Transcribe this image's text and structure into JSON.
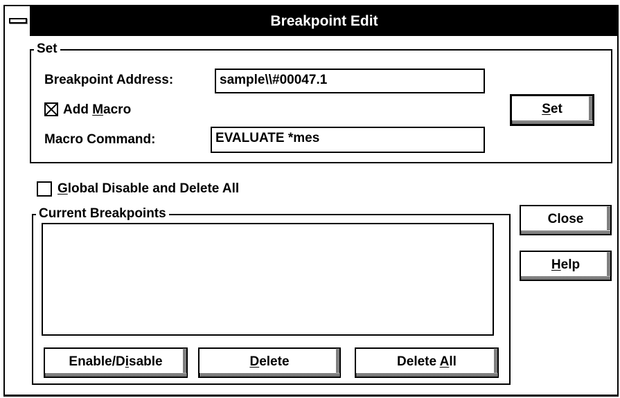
{
  "window": {
    "title": "Breakpoint Edit"
  },
  "set_group": {
    "label": "Set",
    "breakpoint_address_label": "Breakpoint Address:",
    "breakpoint_address_value": "sample\\\\#00047.1",
    "add_macro_label_pre": "Add ",
    "add_macro_label_key": "M",
    "add_macro_label_post": "acro",
    "add_macro_checked": true,
    "macro_command_label": "Macro Command:",
    "macro_command_value": "EVALUATE *mes",
    "set_button_key": "S",
    "set_button_rest": "et"
  },
  "global_disable": {
    "label_key": "G",
    "label_rest": "lobal Disable and Delete All",
    "checked": false
  },
  "current_breakpoints": {
    "label": "Current Breakpoints",
    "items": [],
    "enable_disable_pre": "Enable/D",
    "enable_disable_key": "i",
    "enable_disable_post": "sable",
    "delete_key": "D",
    "delete_rest": "elete",
    "delete_all_pre": "Delete ",
    "delete_all_key": "A",
    "delete_all_post": "ll"
  },
  "side_buttons": {
    "close": "Close",
    "help_key": "H",
    "help_rest": "elp"
  }
}
